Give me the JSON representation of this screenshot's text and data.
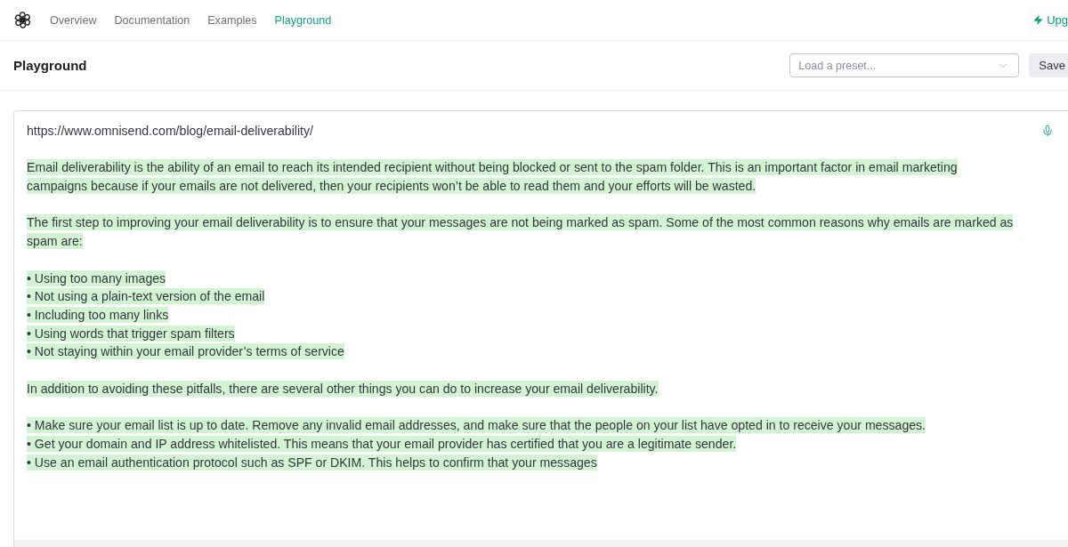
{
  "nav": {
    "items": [
      {
        "label": "Overview",
        "selected": false
      },
      {
        "label": "Documentation",
        "selected": false
      },
      {
        "label": "Examples",
        "selected": false
      },
      {
        "label": "Playground",
        "selected": true
      }
    ],
    "upgrade": {
      "label": "Upg"
    }
  },
  "header": {
    "title": "Playground",
    "preset": {
      "placeholder": "Load a preset..."
    },
    "save": {
      "label": "Save"
    }
  },
  "editor": {
    "blocks": [
      {
        "highlighted": false,
        "lines": [
          "https://www.omnisend.com/blog/email-deliverability/"
        ]
      },
      {
        "highlighted": true,
        "lines": [
          "Email deliverability is the ability of an email to reach its intended recipient without being blocked or sent to the spam folder. This is an important factor in email marketing",
          "campaigns because if your emails are not delivered, then your recipients won’t be able to read them and your efforts will be wasted."
        ]
      },
      {
        "highlighted": true,
        "lines": [
          "The first step to improving your email deliverability is to ensure that your messages are not being marked as spam. Some of the most common reasons why emails are marked as",
          "spam are:"
        ]
      },
      {
        "highlighted": true,
        "lines": [
          "• Using too many images",
          "• Not using a plain-text version of the email",
          "• Including too many links",
          "• Using words that trigger spam filters",
          "• Not staying within your email provider’s terms of service"
        ]
      },
      {
        "highlighted": true,
        "lines": [
          "In addition to avoiding these pitfalls, there are several other things you can do to increase your email deliverability."
        ]
      },
      {
        "highlighted": true,
        "lines": [
          "• Make sure your email list is up to date. Remove any invalid email addresses, and make sure that the people on your list have opted in to receive your messages.",
          "• Get your domain and IP address whitelisted. This means that your email provider has certified that you are a legitimate sender.",
          "• Use an email authentication protocol such as SPF or DKIM. This helps to confirm that your messages"
        ]
      }
    ]
  }
}
